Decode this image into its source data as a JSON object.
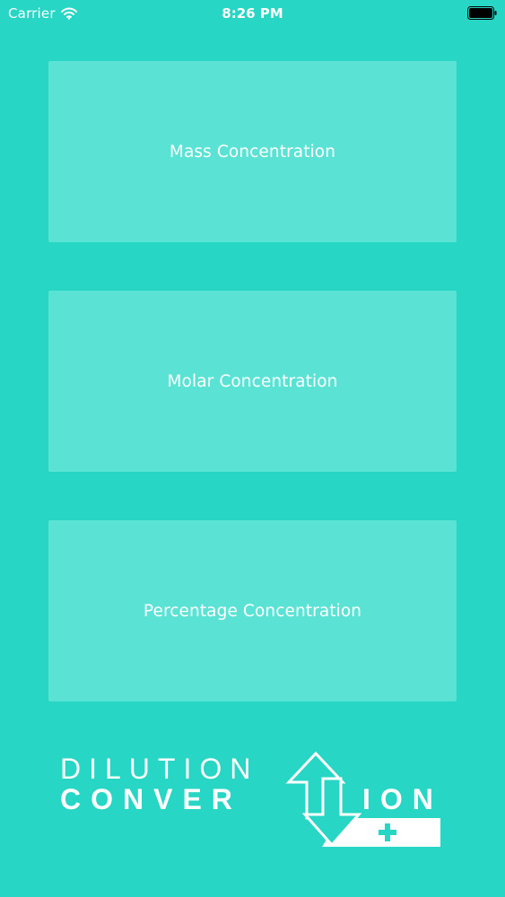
{
  "status_bar": {
    "carrier": "Carrier",
    "time": "8:26 PM",
    "wifi_icon": "wifi-icon",
    "battery_icon": "battery-icon"
  },
  "menu": {
    "items": [
      {
        "label": "Mass Concentration"
      },
      {
        "label": "Molar Concentration"
      },
      {
        "label": "Percentage Concentration"
      }
    ]
  },
  "logo": {
    "line1": "DILUTION",
    "line2_left": "CONVER",
    "line2_right": "ION",
    "plus_icon": "plus-icon",
    "arrows_icon": "up-down-arrows-icon"
  },
  "colors": {
    "background": "#27D6C4",
    "card": "#5AE3D4",
    "text": "#FFFFFF"
  }
}
